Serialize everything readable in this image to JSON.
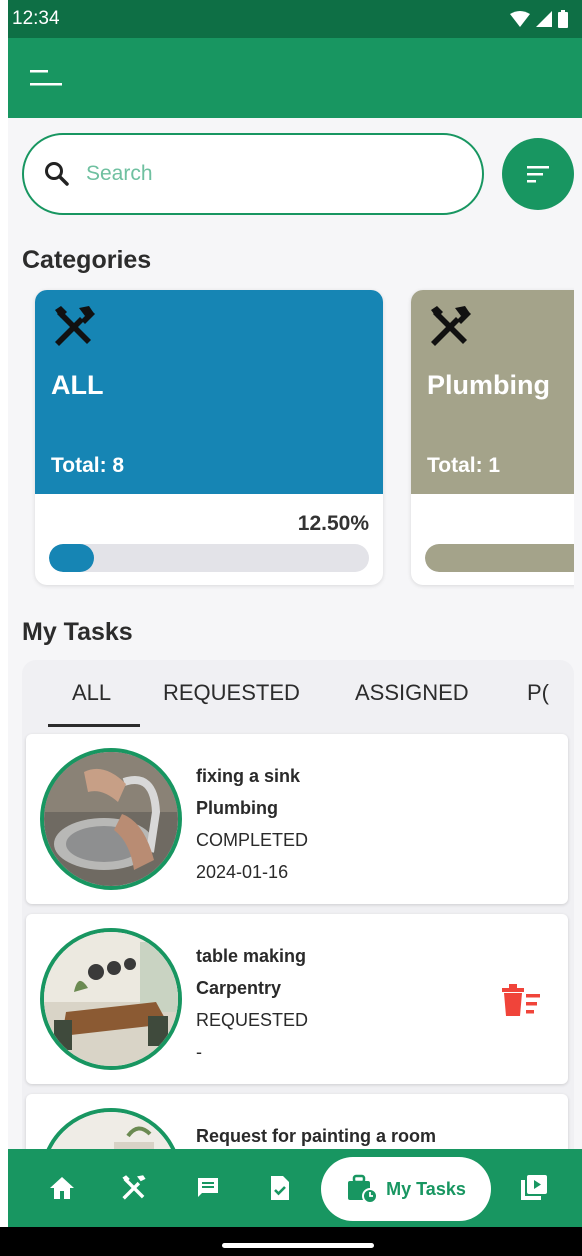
{
  "status_bar": {
    "time": "12:34"
  },
  "search": {
    "placeholder": "Search"
  },
  "categories": {
    "title": "Categories",
    "items": [
      {
        "name": "ALL",
        "total": "Total: 8",
        "percent": "12.50%",
        "progress": 0.125,
        "color": "#1685b4"
      },
      {
        "name": "Plumbing",
        "total": "Total: 1",
        "percent": "",
        "progress": 1.0,
        "color": "#a4a38a"
      }
    ]
  },
  "tasks": {
    "title": "My Tasks",
    "tabs": [
      "ALL",
      "REQUESTED",
      "ASSIGNED",
      "P("
    ],
    "items": [
      {
        "title": "fixing a sink",
        "category": "Plumbing",
        "status": "COMPLETED",
        "date": "2024-01-16",
        "image": "sink-photo"
      },
      {
        "title": "table making",
        "category": "Carpentry",
        "status": "REQUESTED",
        "date": "-",
        "image": "dining-table-photo",
        "delete_icon": "delete-sweep-icon"
      },
      {
        "title": "Request for painting a room",
        "category": "",
        "status": "",
        "date": "",
        "image": "room-photo"
      }
    ]
  },
  "bottom_nav": {
    "active_label": "My Tasks",
    "icons": [
      "home-icon",
      "tools-icon",
      "chat-icon",
      "task-check-icon",
      "my-tasks-icon",
      "video-icon"
    ]
  },
  "colors": {
    "primary": "#189661",
    "status_bar": "#0e6f45",
    "delete": "#f0443a"
  }
}
